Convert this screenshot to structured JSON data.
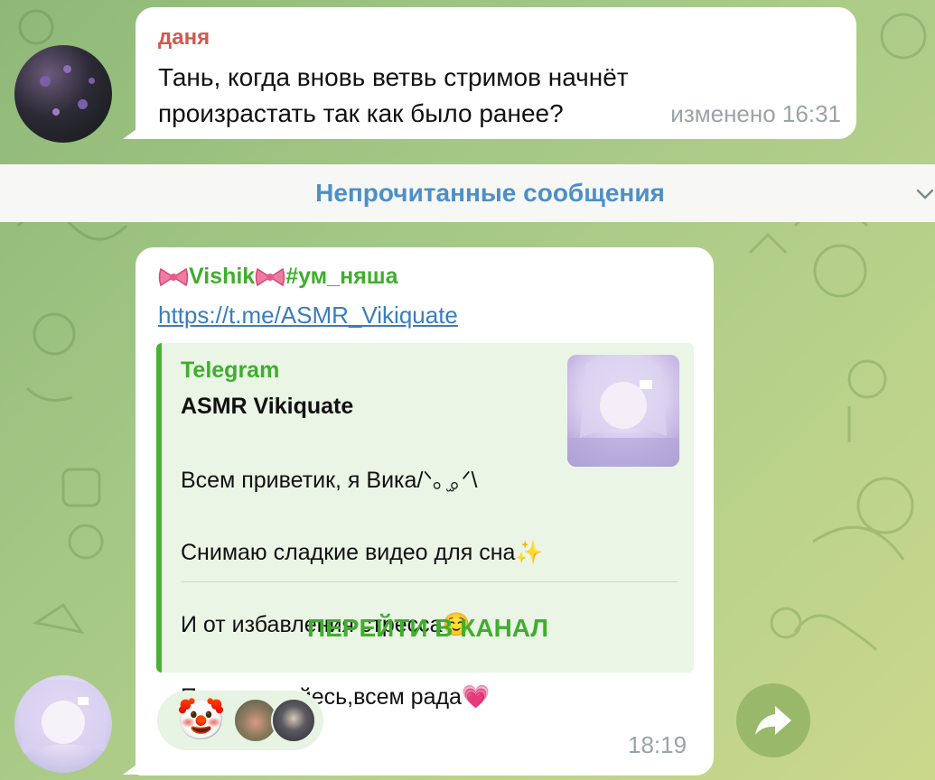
{
  "messages": [
    {
      "sender": "даня",
      "text": "Тань, когда вновь ветвь стримов начнёт произрастать так как было ранее?",
      "status": "изменено 16:31"
    },
    {
      "sender_name": "Vishik",
      "sender_tag": "#ум_няша",
      "link": "https://t.me/ASMR_Vikiquate",
      "preview": {
        "site": "Telegram",
        "title": "ASMR Vikiquate",
        "description_lines": [
          "Всем приветик, я Вика/ᐠ｡ ̫｡ᐟ\\",
          "Снимаю сладкие видео для сна✨",
          "И от избавления стресса☺️",
          "Подписывайесь,всем рада💗"
        ],
        "button_label": "ПЕРЕЙТИ В КАНАЛ"
      },
      "reaction_emoji": "🤡",
      "time": "18:19"
    }
  ],
  "unread_separator": "Непрочитанные сообщения",
  "icons": {
    "share": "share-arrow-icon",
    "chevron": "chevron-down-icon",
    "bow": "ribbon-bow-icon"
  },
  "colors": {
    "sender1": "#d4584c",
    "sender2": "#3fae2d",
    "link": "#3b7dbd",
    "unread": "#4d8fc9",
    "accent_bar": "#49b233"
  }
}
